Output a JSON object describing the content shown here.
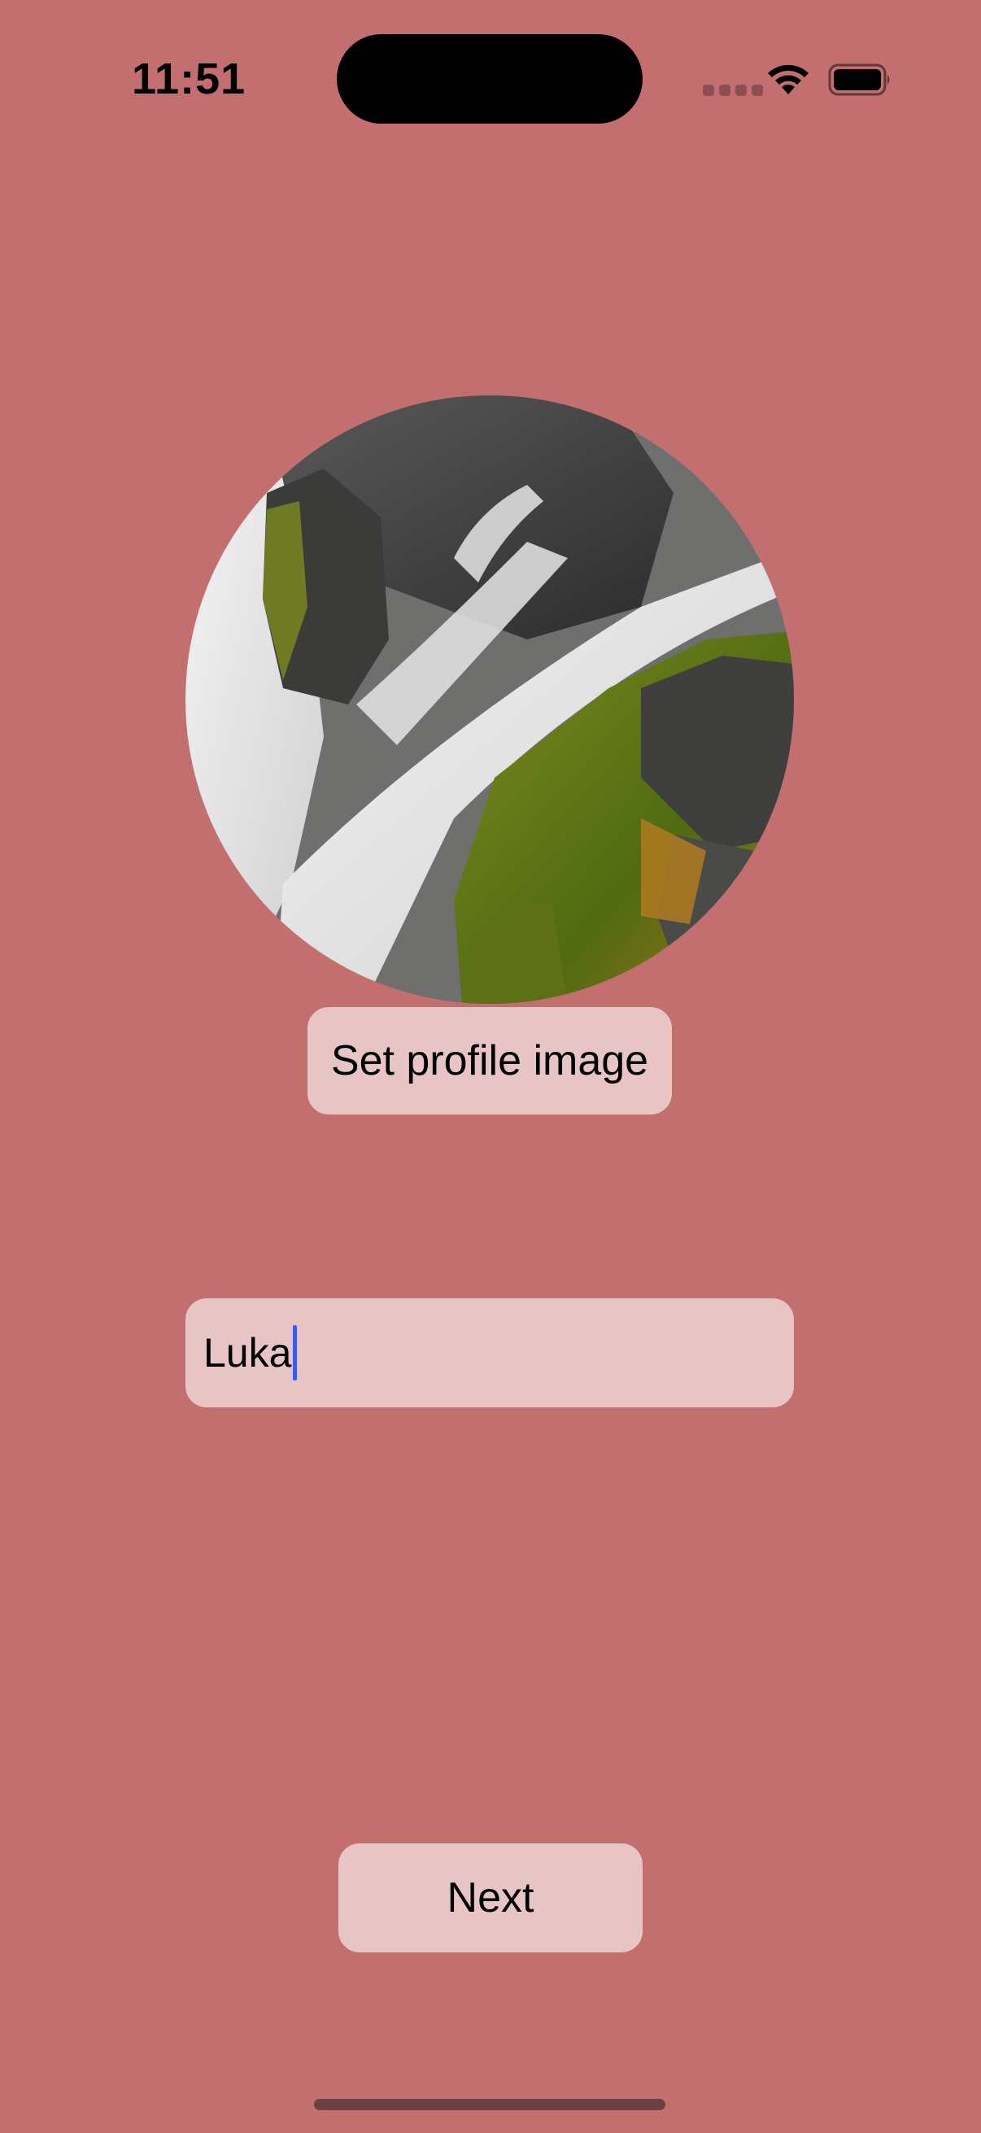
{
  "status_bar": {
    "time": "11:51"
  },
  "profile": {
    "image_icon": "waterfall-photo",
    "set_image_label": "Set profile image"
  },
  "name_field": {
    "value": "Luka"
  },
  "actions": {
    "next_label": "Next"
  },
  "colors": {
    "background": "#c36f70",
    "control_fill": "#e8c5c5",
    "caret": "#3b5bf5"
  }
}
